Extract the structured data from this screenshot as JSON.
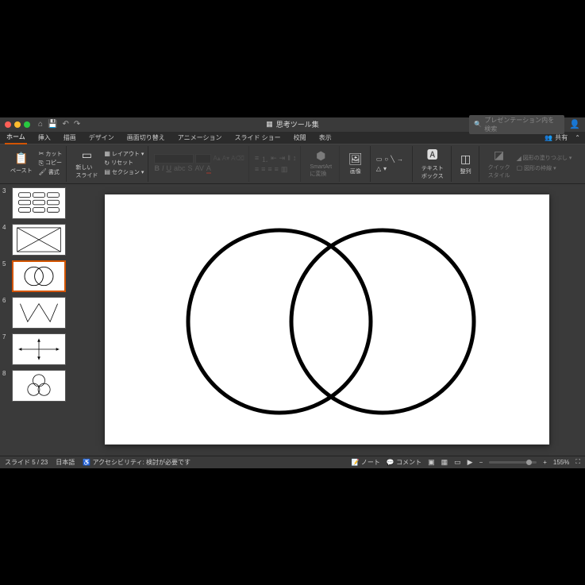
{
  "titlebar": {
    "title": "思考ツール集",
    "search_placeholder": "プレゼンテーション内を検索"
  },
  "tabs": {
    "home": "ホーム",
    "insert": "挿入",
    "draw": "描画",
    "design": "デザイン",
    "transitions": "画面切り替え",
    "animations": "アニメーション",
    "slideshow": "スライド ショー",
    "review": "校閲",
    "view": "表示",
    "share": "共有"
  },
  "ribbon": {
    "paste": "ペースト",
    "cut": "カット",
    "copy": "コピー",
    "format": "書式",
    "new_slide": "新しい\nスライド",
    "layout": "レイアウト",
    "reset": "リセット",
    "section": "セクション",
    "convert_smartart": "SmartArt\nに変換",
    "picture": "画像",
    "textbox": "テキスト\nボックス",
    "arrange": "整列",
    "quick_styles": "クイック\nスタイル",
    "shape_fill": "図形の塗りつぶし",
    "shape_outline": "図形の枠線"
  },
  "thumbs": {
    "n3": "3",
    "n4": "4",
    "n5": "5",
    "n6": "6",
    "n7": "7",
    "n8": "8"
  },
  "statusbar": {
    "slide_info": "スライド 5 / 23",
    "language": "日本語",
    "accessibility": "アクセシビリティ: 検討が必要です",
    "notes": "ノート",
    "comments": "コメント",
    "zoom": "155%"
  }
}
